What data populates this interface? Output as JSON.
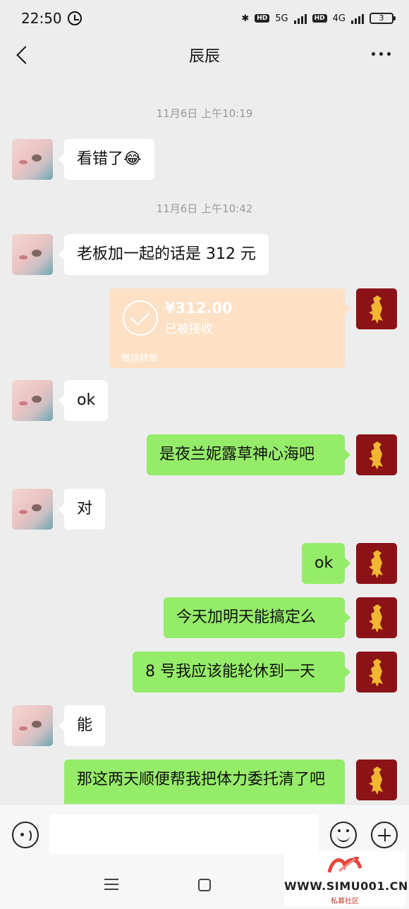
{
  "status_bar": {
    "time": "22:50",
    "network_5g": "5G",
    "network_4g": "4G",
    "hd_label": "HD",
    "battery": "3"
  },
  "header": {
    "title": "辰辰"
  },
  "messages": {
    "ts1": "11月6日 上午10:19",
    "m1": "看错了😂",
    "ts2": "11月6日 上午10:42",
    "m2": "老板加一起的话是 312 元",
    "transfer": {
      "amount": "¥312.00",
      "status": "已被接收",
      "footer": "微信转账"
    },
    "m3": "ok",
    "m4": "是夜兰妮露草神心海吧",
    "m5": "对",
    "m6": "ok",
    "m7": "今天加明天能搞定么",
    "m8": "8 号我应该能轮休到一天",
    "m9": "能",
    "m10": "那这两天顺便帮我把体力委托清了吧"
  },
  "watermark": {
    "site": "WWW.SIMU001.CN",
    "sub": "私募社区"
  },
  "colors": {
    "background": "#ededed",
    "outgoing_bubble": "#95ec69",
    "incoming_bubble": "#ffffff",
    "transfer_card": "#fde1c6",
    "my_avatar": "#8b1217"
  }
}
